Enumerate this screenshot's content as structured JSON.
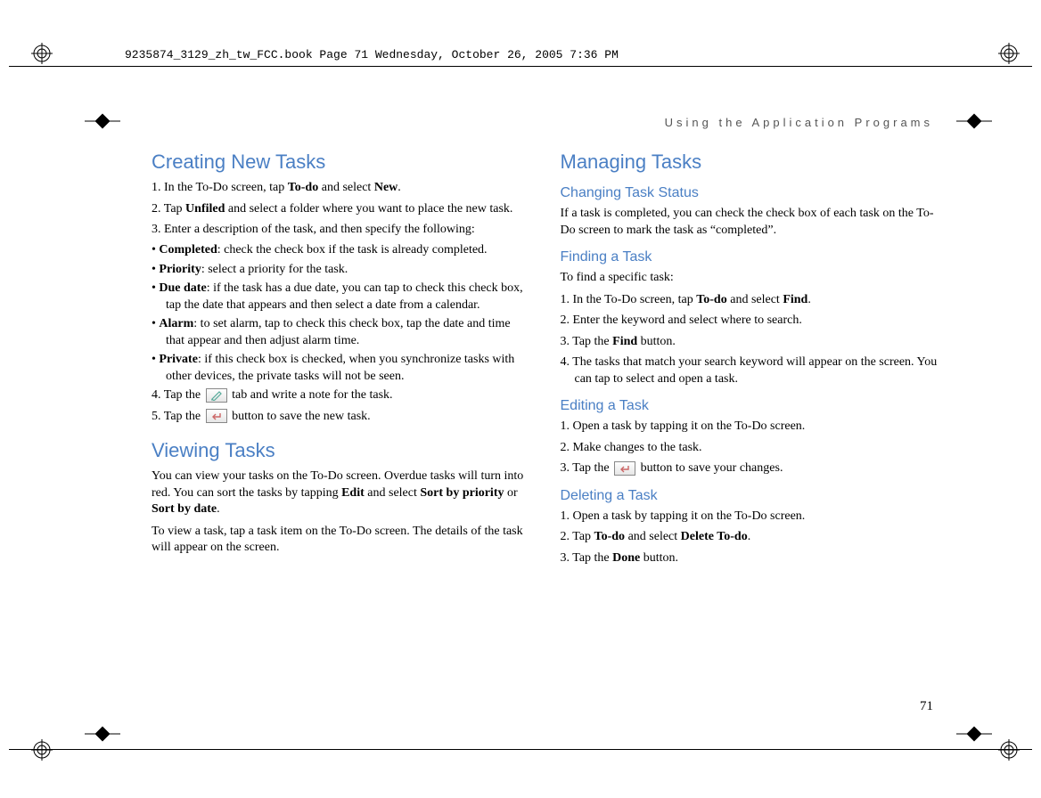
{
  "meta": {
    "book_header": "9235874_3129_zh_tw_FCC.book  Page 71  Wednesday, October 26, 2005  7:36 PM"
  },
  "page": {
    "header": "Using the Application Programs",
    "number": "71"
  },
  "left": {
    "h1": "Creating New Tasks",
    "s1_pre": "1. In the To-Do screen, tap ",
    "s1_b1": "To-do",
    "s1_mid": " and select ",
    "s1_b2": "New",
    "s1_end": ".",
    "s2_pre": "2. Tap ",
    "s2_b1": "Unfiled",
    "s2_end": " and select a folder where you want to place the new task.",
    "s3": "3. Enter a description of the task, and then specify the following:",
    "bul_completed_b": "Completed",
    "bul_completed_t": ": check the check box if the task is already completed.",
    "bul_priority_b": "Priority",
    "bul_priority_t": ": select a priority for the task.",
    "bul_duedate_b": "Due date",
    "bul_duedate_t": ": if the task has a due date, you can tap to check this check box, tap the date that appears and then select a date from a calendar.",
    "bul_alarm_b": "Alarm",
    "bul_alarm_t": ": to set alarm, tap to check this check box, tap the date and time that appear and then adjust alarm time.",
    "bul_private_b": "Private",
    "bul_private_t": ": if this check box is checked, when you synchronize tasks with other devices, the private tasks will not be seen.",
    "s4_pre": "4. Tap the ",
    "s4_post": " tab and write a note for the task.",
    "s5_pre": "5. Tap the ",
    "s5_post": " button to save the new task.",
    "h2": "Viewing Tasks",
    "view_p1_pre": "You can view your tasks on the To-Do screen. Overdue tasks will turn into red. You can sort the tasks by tapping ",
    "view_p1_b1": "Edit",
    "view_p1_mid": " and select ",
    "view_p1_b2": "Sort by priority",
    "view_p1_or": " or ",
    "view_p1_b3": "Sort by date",
    "view_p1_end": ".",
    "view_p2": "To view a task, tap a task item on the To-Do screen. The details of the task will appear on the screen."
  },
  "right": {
    "h1": "Managing Tasks",
    "sub1": "Changing Task Status",
    "chg_p": "If a task is completed, you can check the check box of each task on the To-Do screen to mark the task as “completed”.",
    "sub2": "Finding a Task",
    "find_intro": "To find a specific task:",
    "find_s1_pre": "1. In the To-Do screen, tap ",
    "find_s1_b1": "To-do",
    "find_s1_mid": " and select ",
    "find_s1_b2": "Find",
    "find_s1_end": ".",
    "find_s2": "2. Enter the keyword and select where to search.",
    "find_s3_pre": "3. Tap the ",
    "find_s3_b": "Find",
    "find_s3_end": " button.",
    "find_s4": "4. The tasks that match your search keyword will appear on the screen. You can tap to select and open a task.",
    "sub3": "Editing a Task",
    "edit_s1": "1. Open a task by tapping it on the To-Do screen.",
    "edit_s2": "2. Make changes to the task.",
    "edit_s3_pre": "3. Tap the ",
    "edit_s3_post": " button to save your changes.",
    "sub4": "Deleting a Task",
    "del_s1": "1. Open a task by tapping it on the To-Do screen.",
    "del_s2_pre": "2. Tap ",
    "del_s2_b1": "To-do",
    "del_s2_mid": " and select ",
    "del_s2_b2": "Delete To-do",
    "del_s2_end": ".",
    "del_s3_pre": "3. Tap the ",
    "del_s3_b": "Done",
    "del_s3_end": " button."
  }
}
